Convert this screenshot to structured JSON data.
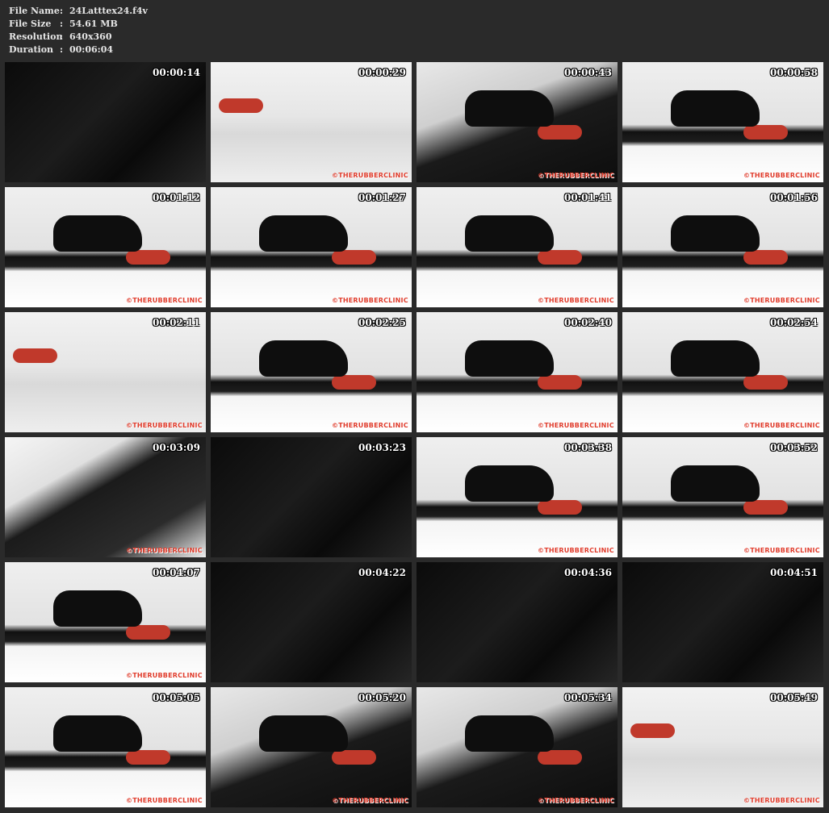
{
  "file_info": {
    "name_label": "File Name",
    "name_value": "24Latttex24.f4v",
    "size_label": "File Size",
    "size_value": "54.61 MB",
    "resolution_label": "Resolution",
    "resolution_value": "640x360",
    "duration_label": "Duration",
    "duration_value": "00:06:04",
    "colon": ":"
  },
  "thumbnails": [
    {
      "timestamp": "00:00:14",
      "scene": "dark"
    },
    {
      "timestamp": "00:00:29",
      "scene": "room"
    },
    {
      "timestamp": "00:00:43",
      "scene": "closeup"
    },
    {
      "timestamp": "00:00:58",
      "scene": "bed"
    },
    {
      "timestamp": "00:01:12",
      "scene": "bed"
    },
    {
      "timestamp": "00:01:27",
      "scene": "bed"
    },
    {
      "timestamp": "00:01:41",
      "scene": "bed"
    },
    {
      "timestamp": "00:01:56",
      "scene": "bed"
    },
    {
      "timestamp": "00:02:11",
      "scene": "room"
    },
    {
      "timestamp": "00:02:25",
      "scene": "bed"
    },
    {
      "timestamp": "00:02:40",
      "scene": "bed"
    },
    {
      "timestamp": "00:02:54",
      "scene": "bed"
    },
    {
      "timestamp": "00:03:09",
      "scene": "angled"
    },
    {
      "timestamp": "00:03:23",
      "scene": "dark"
    },
    {
      "timestamp": "00:03:38",
      "scene": "bed"
    },
    {
      "timestamp": "00:03:52",
      "scene": "bed"
    },
    {
      "timestamp": "00:04:07",
      "scene": "bed"
    },
    {
      "timestamp": "00:04:22",
      "scene": "dark"
    },
    {
      "timestamp": "00:04:36",
      "scene": "dark"
    },
    {
      "timestamp": "00:04:51",
      "scene": "dark"
    },
    {
      "timestamp": "00:05:05",
      "scene": "bed"
    },
    {
      "timestamp": "00:05:20",
      "scene": "closeup"
    },
    {
      "timestamp": "00:05:34",
      "scene": "closeup"
    },
    {
      "timestamp": "00:05:49",
      "scene": "room"
    }
  ],
  "watermark": "©THERUBBERCLINIC",
  "colors": {
    "background": "#2a2a2a",
    "info_text": "#e6e6e6",
    "watermark": "#e03c2c",
    "timestamp": "#ffffff"
  }
}
